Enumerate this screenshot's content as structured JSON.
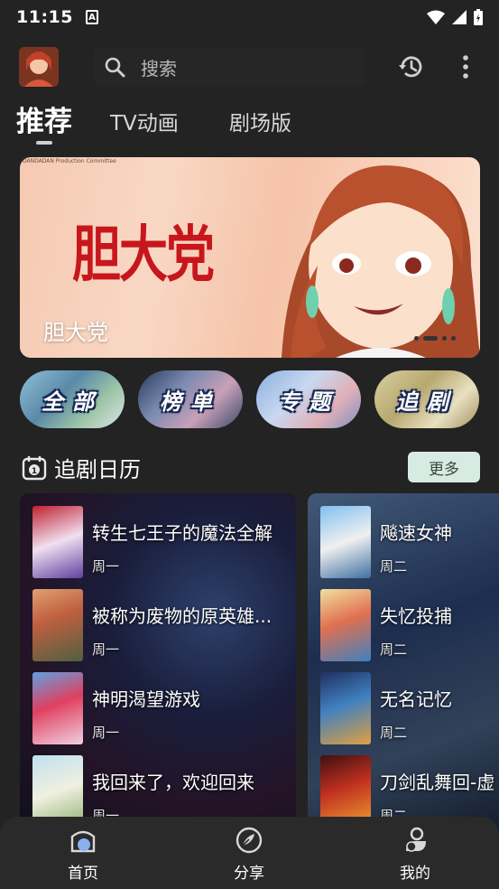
{
  "status_bar": {
    "time": "11:15",
    "app_badge": "A"
  },
  "top_bar": {
    "search_placeholder": "搜索"
  },
  "tabs": [
    {
      "label": "推荐",
      "active": true
    },
    {
      "label": "TV动画",
      "active": false
    },
    {
      "label": "剧场版",
      "active": false
    }
  ],
  "banner": {
    "copyright": "DANDADAN Production Committee",
    "logo_text": "胆大党",
    "title": "胆大党",
    "page_count": 4,
    "active_page": 2
  },
  "categories": [
    {
      "label": "全部"
    },
    {
      "label": "榜单"
    },
    {
      "label": "专题"
    },
    {
      "label": "追剧"
    }
  ],
  "schedule": {
    "title": "追剧日历",
    "more_label": "更多",
    "columns": [
      {
        "items": [
          {
            "name": "转生七王子的魔法全解",
            "day": "周一"
          },
          {
            "name": "被称为废物的原英雄...",
            "day": "周一"
          },
          {
            "name": "神明渴望游戏",
            "day": "周一"
          },
          {
            "name": "我回来了，欢迎回来",
            "day": "周一"
          }
        ]
      },
      {
        "items": [
          {
            "name": "飚速女神",
            "day": "周二"
          },
          {
            "name": "失忆投捕",
            "day": "周二"
          },
          {
            "name": "无名记忆",
            "day": "周二"
          },
          {
            "name": "刀剑乱舞回-虚",
            "day": "周二"
          }
        ]
      }
    ]
  },
  "bottom_nav": [
    {
      "label": "首页",
      "active": true
    },
    {
      "label": "分享",
      "active": false
    },
    {
      "label": "我的",
      "active": false
    }
  ],
  "colors": {
    "background": "#232323",
    "banner_logo": "#c8161d",
    "more_button": "#d7ebe2",
    "nav_background": "#2a2a2a"
  }
}
